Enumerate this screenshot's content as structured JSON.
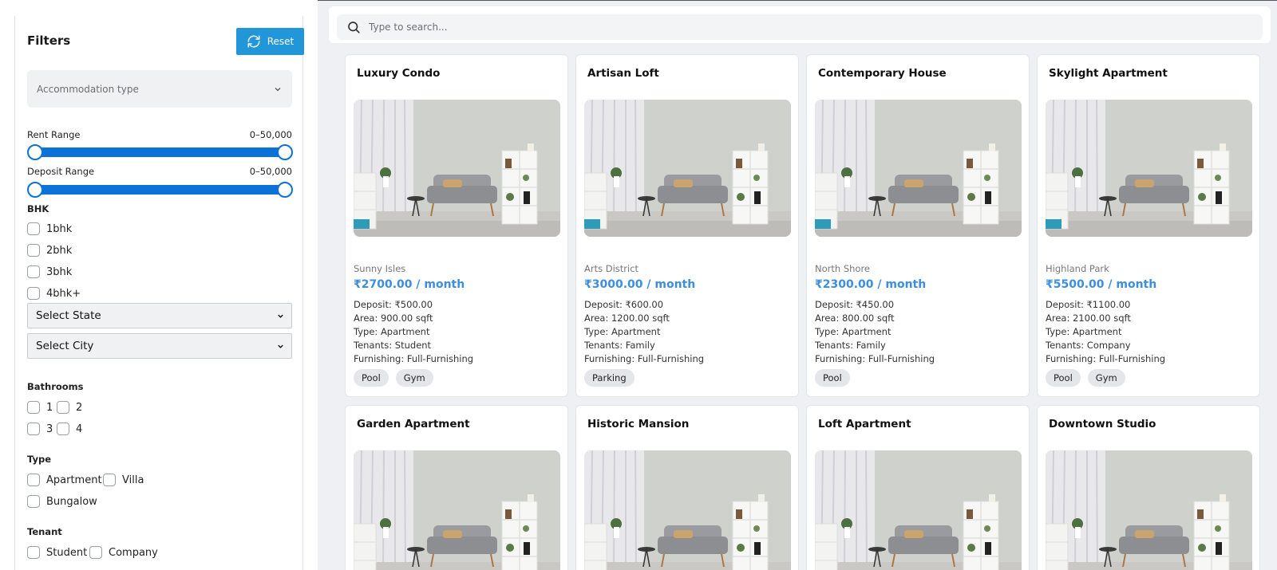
{
  "filters": {
    "title": "Filters",
    "reset_label": "Reset",
    "accommodation_placeholder": "Accommodation type",
    "rent": {
      "label": "Rent Range",
      "value": "0–50,000",
      "min": 0,
      "max": 50000
    },
    "deposit": {
      "label": "Deposit Range",
      "value": "0–50,000",
      "min": 0,
      "max": 50000
    },
    "bhk": {
      "label": "BHK",
      "options": [
        "1bhk",
        "2bhk",
        "3bhk",
        "4bhk+"
      ]
    },
    "state_select": "Select State",
    "city_select": "Select City",
    "bathrooms": {
      "label": "Bathrooms",
      "options": [
        "1",
        "2",
        "3",
        "4"
      ]
    },
    "type": {
      "label": "Type",
      "options": [
        "Apartment",
        "Villa",
        "Bungalow"
      ]
    },
    "tenant": {
      "label": "Tenant",
      "options": [
        "Student",
        "Company"
      ]
    }
  },
  "search": {
    "placeholder": "Type to search..."
  },
  "listings": [
    {
      "title": "Luxury Condo",
      "location": "Sunny Isles",
      "price": "₹2700.00 / month",
      "deposit": "Deposit: ₹500.00",
      "area": "Area: 900.00 sqft",
      "type": "Type: Apartment",
      "tenants": "Tenants: Student",
      "furnishing": "Furnishing: Full-Furnishing",
      "amenities": [
        "Pool",
        "Gym"
      ]
    },
    {
      "title": "Artisan Loft",
      "location": "Arts District",
      "price": "₹3000.00 / month",
      "deposit": "Deposit: ₹600.00",
      "area": "Area: 1200.00 sqft",
      "type": "Type: Apartment",
      "tenants": "Tenants: Family",
      "furnishing": "Furnishing: Full-Furnishing",
      "amenities": [
        "Parking"
      ]
    },
    {
      "title": "Contemporary House",
      "location": "North Shore",
      "price": "₹2300.00 / month",
      "deposit": "Deposit: ₹450.00",
      "area": "Area: 800.00 sqft",
      "type": "Type: Apartment",
      "tenants": "Tenants: Family",
      "furnishing": "Furnishing: Full-Furnishing",
      "amenities": [
        "Pool"
      ]
    },
    {
      "title": "Skylight Apartment",
      "location": "Highland Park",
      "price": "₹5500.00 / month",
      "deposit": "Deposit: ₹1100.00",
      "area": "Area: 2100.00 sqft",
      "type": "Type: Apartment",
      "tenants": "Tenants: Company",
      "furnishing": "Furnishing: Full-Furnishing",
      "amenities": [
        "Pool",
        "Gym"
      ]
    },
    {
      "title": "Garden Apartment"
    },
    {
      "title": "Historic Mansion"
    },
    {
      "title": "Loft Apartment"
    },
    {
      "title": "Downtown Studio"
    }
  ],
  "icons": {
    "reset": "refresh-icon",
    "search": "search-icon",
    "dropdown": "chevron-down-icon"
  },
  "colors": {
    "accent": "#2196d9",
    "slider": "#0a72d8",
    "price": "#3b8ee0"
  }
}
